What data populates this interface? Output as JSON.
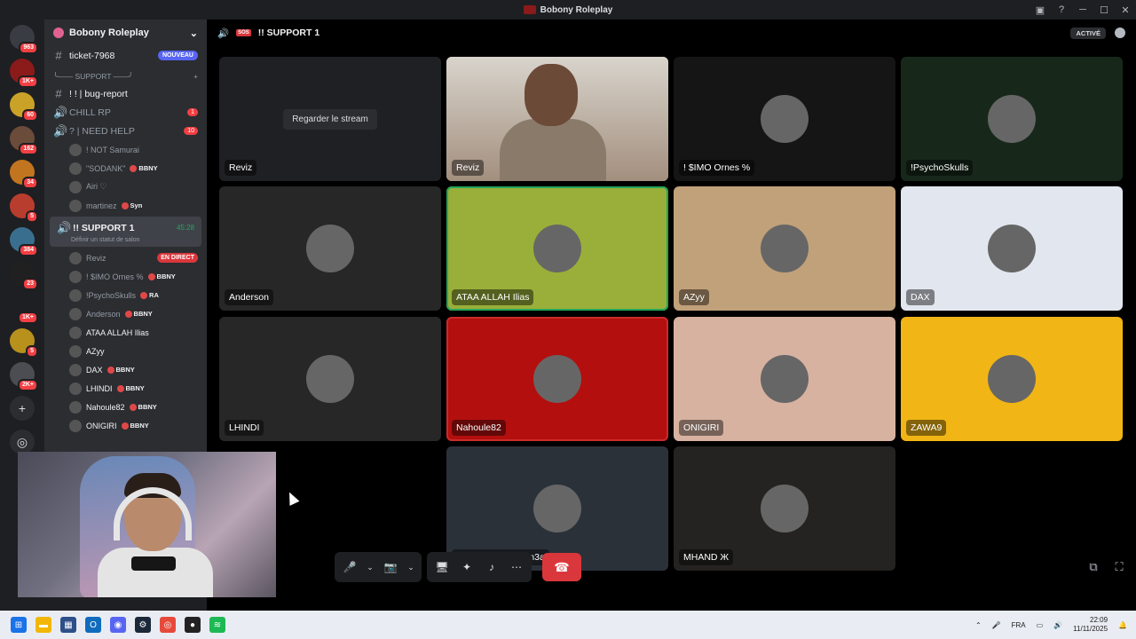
{
  "window": {
    "title": "Bobony Roleplay",
    "controls": [
      "─",
      "☐",
      "✕"
    ]
  },
  "server_rail": {
    "items": [
      {
        "badge": "963",
        "color": "#3a3c43"
      },
      {
        "badge": "1K+",
        "color": "#8b1a1a"
      },
      {
        "badge": "60",
        "color": "#c9a227"
      },
      {
        "badge": "162",
        "color": "#6b4b3a"
      },
      {
        "badge": "34",
        "color": "#c2751f"
      },
      {
        "badge": "5",
        "color": "#b93d2e"
      },
      {
        "badge": "384",
        "color": "#3a6e8f"
      },
      {
        "badge": "23",
        "color": "#202020"
      },
      {
        "badge": "1K+",
        "color": "#1e1f22"
      },
      {
        "badge": "5",
        "color": "#b8911d"
      },
      {
        "badge": "2K+",
        "color": "#4b4d52"
      }
    ],
    "add": "+",
    "explore": "◎"
  },
  "sidebar": {
    "guild_name": "Bobony Roleplay",
    "ticket": {
      "name": "ticket-7968",
      "badge": "NOUVEAU"
    },
    "category": "╰—— SUPPORT ——╯",
    "bug_report": "! ! | bug-report",
    "chill": {
      "name": "CHILL RP",
      "count": "1"
    },
    "need_help": {
      "name": "? | NEED HELP",
      "count": "10"
    },
    "need_help_users": [
      {
        "name": "! NOT Samurai",
        "tag": ""
      },
      {
        "name": "\"SODANK\"",
        "tag": "BBNY"
      },
      {
        "name": "Airi ♡",
        "tag": ""
      },
      {
        "name": "martinez",
        "tag": "Syn"
      }
    ],
    "support1": {
      "name": "!! SUPPORT 1",
      "timer": "45:28",
      "status": "Définir un statut de salon"
    },
    "support1_users": [
      {
        "name": "Reviz",
        "tag": "",
        "live": "EN DIRECT"
      },
      {
        "name": "! $IMO Ornes %",
        "tag": "BBNY"
      },
      {
        "name": "!PsychoSkulls",
        "tag": "RA"
      },
      {
        "name": "Anderson",
        "tag": "BBNY"
      },
      {
        "name": "ATAA ALLAH Ilias",
        "tag": ""
      },
      {
        "name": "AZyy",
        "tag": ""
      },
      {
        "name": "DAX",
        "tag": "BBNY"
      },
      {
        "name": "LHINDI",
        "tag": "BBNY"
      },
      {
        "name": "Nahoule82",
        "tag": "BBNY"
      },
      {
        "name": "ONIGIRI",
        "tag": "BBNY"
      }
    ]
  },
  "stage": {
    "channel_name": "!! SUPPORT 1",
    "sos": "SOS",
    "activity": "ACTIVÉ",
    "watch_stream": "Regarder le stream",
    "tiles": [
      {
        "name": "Reviz",
        "type": "stream",
        "bg": "#1f2024"
      },
      {
        "name": "Reviz",
        "type": "camera",
        "bg": "#c9b8a8"
      },
      {
        "name": "! $IMO Ornes %",
        "type": "avatar",
        "bg": "#151515"
      },
      {
        "name": "!PsychoSkulls",
        "type": "avatar",
        "bg": "#17281a"
      },
      {
        "name": "Anderson",
        "type": "avatar",
        "bg": "#262726"
      },
      {
        "name": "ATAA ALLAH Ilias",
        "type": "avatar",
        "bg": "#9aaf3a"
      },
      {
        "name": "AZyy",
        "type": "avatar",
        "bg": "#c1a17a"
      },
      {
        "name": "DAX",
        "type": "avatar",
        "bg": "#e2e6ee"
      },
      {
        "name": "LHINDI",
        "type": "avatar",
        "bg": "#262726"
      },
      {
        "name": "Nahoule82",
        "type": "avatar",
        "bg": "#b40f0f"
      },
      {
        "name": "ONIGIRI",
        "type": "avatar",
        "bg": "#d8b2a0"
      },
      {
        "name": "ZAWA9",
        "type": "avatar",
        "bg": "#f1b515"
      },
      {
        "name": "DrHoussam Boujm3a",
        "type": "avatar",
        "bg": "#2b3138"
      },
      {
        "name": "MHAND Ж",
        "type": "avatar",
        "bg": "#242321"
      }
    ]
  },
  "controls": {
    "mic": "🎤",
    "camera": "📷",
    "screen": "🖥",
    "activities": "✦",
    "soundboard": "♪",
    "more": "⋯",
    "hangup": "☎"
  },
  "taskbar": {
    "lang": "FRA",
    "time": "22:09",
    "date": "11/11/2025"
  }
}
